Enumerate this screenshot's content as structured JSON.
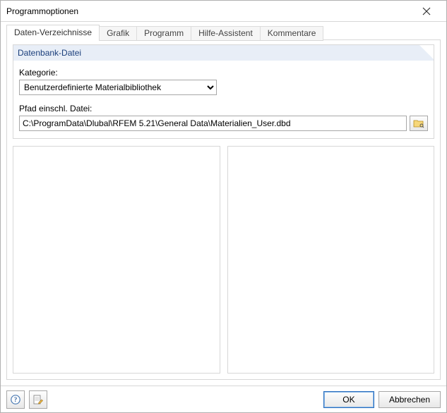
{
  "window": {
    "title": "Programmoptionen"
  },
  "tabs": {
    "data_verz": "Daten-Verzeichnisse",
    "grafik": "Grafik",
    "programm": "Programm",
    "hilfe": "Hilfe-Assistent",
    "kommentare": "Kommentare"
  },
  "group": {
    "header": "Datenbank-Datei",
    "kategorie_label": "Kategorie:",
    "kategorie_value": "Benutzerdefinierte Materialbibliothek",
    "pfad_label": "Pfad einschl. Datei:",
    "pfad_value": "C:\\ProgramData\\Dlubal\\RFEM 5.21\\General Data\\Materialien_User.dbd"
  },
  "buttons": {
    "ok": "OK",
    "cancel": "Abbrechen"
  }
}
